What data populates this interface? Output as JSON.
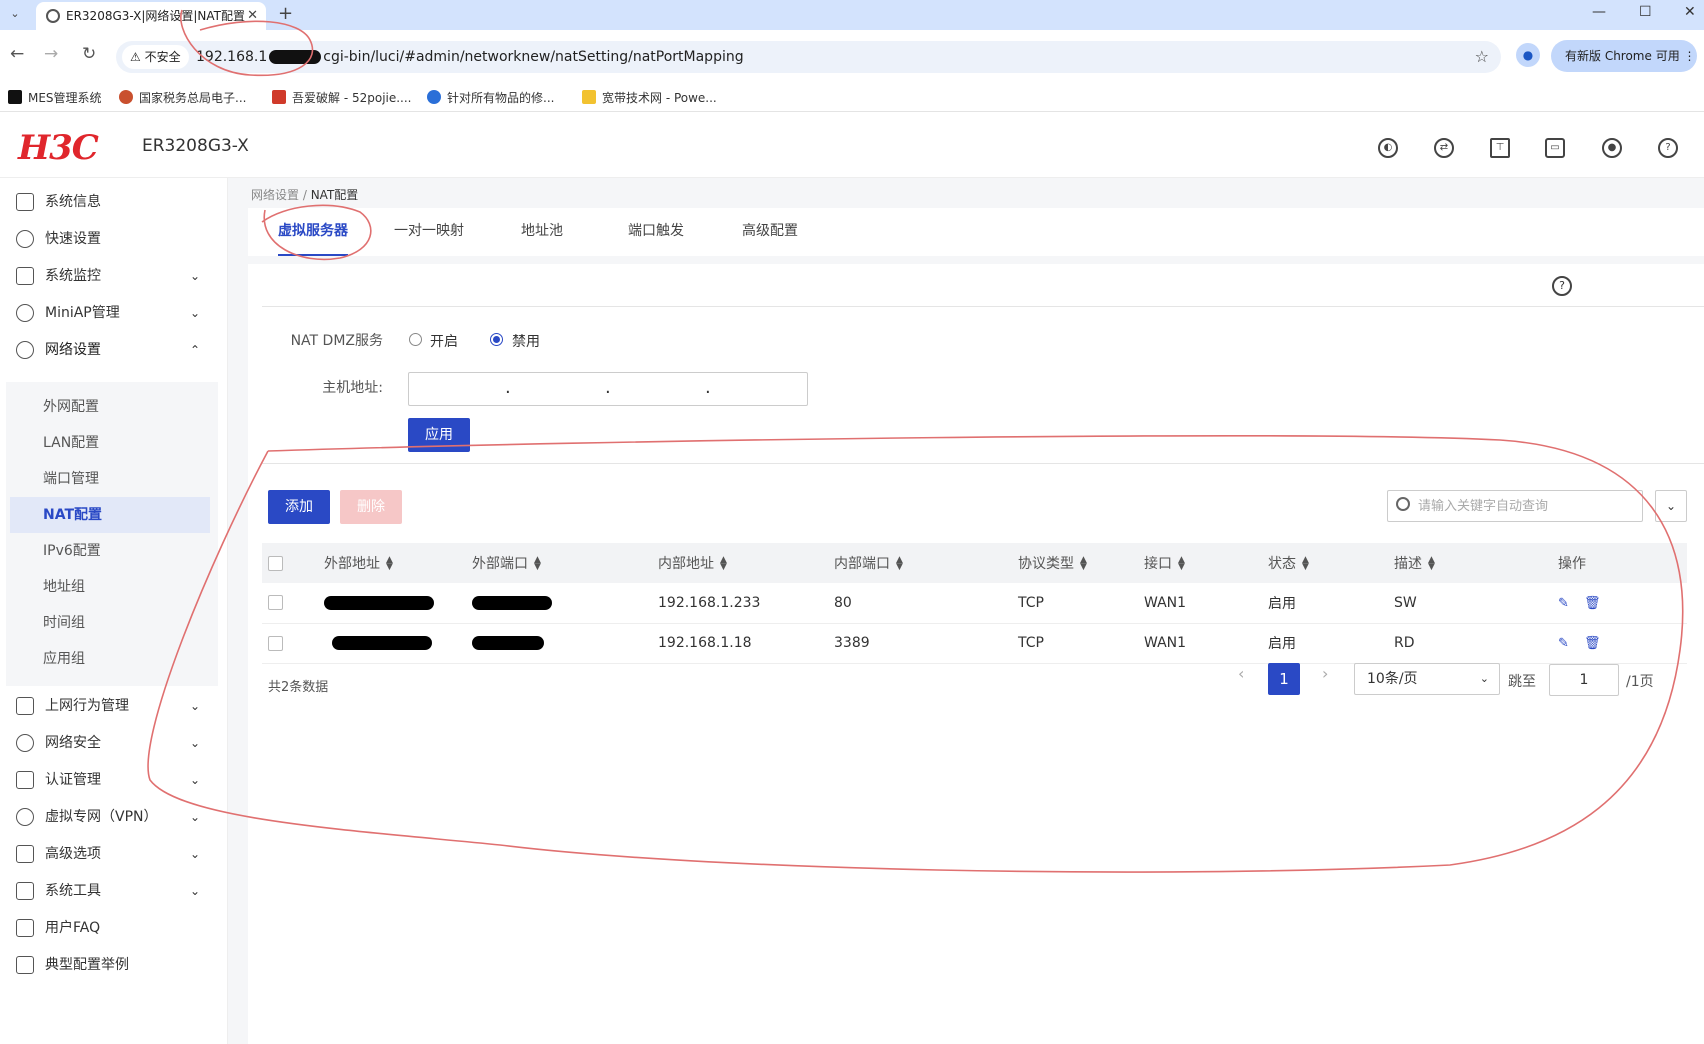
{
  "browser": {
    "tab_title": "ER3208G3-X|网络设置|NAT配置",
    "tab_close": "✕",
    "new_tab": "+",
    "security_label": "不安全",
    "url_prefix": "192.168.1",
    "url_suffix": "cgi-bin/luci/#admin/networknew/natSetting/natPortMapping",
    "update_label": "有新版 Chrome 可用",
    "bookmarks": [
      "MES管理系统",
      "国家税务总局电子...",
      "吾爱破解 - 52pojie....",
      "针对所有物品的修...",
      "宽带技术网 - Powe..."
    ]
  },
  "header": {
    "logo": "H3C",
    "model": "ER3208G3-X"
  },
  "sidebar": {
    "items": [
      {
        "label": "系统信息"
      },
      {
        "label": "快速设置"
      },
      {
        "label": "系统监控"
      },
      {
        "label": "MiniAP管理"
      },
      {
        "label": "网络设置"
      },
      {
        "label": "上网行为管理"
      },
      {
        "label": "网络安全"
      },
      {
        "label": "认证管理"
      },
      {
        "label": "虚拟专网（VPN）"
      },
      {
        "label": "高级选项"
      },
      {
        "label": "系统工具"
      },
      {
        "label": "用户FAQ"
      },
      {
        "label": "典型配置举例"
      }
    ],
    "sub_items": [
      "外网配置",
      "LAN配置",
      "端口管理",
      "NAT配置",
      "IPv6配置",
      "地址组",
      "时间组",
      "应用组"
    ]
  },
  "breadcrumb": {
    "parent": "网络设置 / ",
    "current": "NAT配置"
  },
  "tabs": [
    "虚拟服务器",
    "一对一映射",
    "地址池",
    "端口触发",
    "高级配置"
  ],
  "dmz": {
    "label": "NAT DMZ服务",
    "on_label": "开启",
    "off_label": "禁用",
    "selected": "禁用",
    "host_label": "主机地址:",
    "apply_label": "应用"
  },
  "toolbar": {
    "add_label": "添加",
    "delete_label": "删除",
    "search_placeholder": "请输入关键字自动查询"
  },
  "table": {
    "columns": [
      "外部地址",
      "外部端口",
      "内部地址",
      "内部端口",
      "协议类型",
      "接口",
      "状态",
      "描述",
      "操作"
    ],
    "rows": [
      {
        "internal_addr": "192.168.1.233",
        "internal_port": "80",
        "protocol": "TCP",
        "iface": "WAN1",
        "status": "启用",
        "desc": "SW"
      },
      {
        "internal_addr": "192.168.1.18",
        "internal_port": "3389",
        "protocol": "TCP",
        "iface": "WAN1",
        "status": "启用",
        "desc": "RD"
      }
    ]
  },
  "pagination": {
    "total": "共2条数据",
    "prev": "‹",
    "next": "›",
    "current": "1",
    "page_size": "10条/页",
    "jump_label": "跳至",
    "jump_value": "1",
    "pages": "/1页"
  },
  "colors": {
    "accent": "#2a49c5",
    "brand_red": "#e0262c",
    "annotation": "#e07070"
  }
}
